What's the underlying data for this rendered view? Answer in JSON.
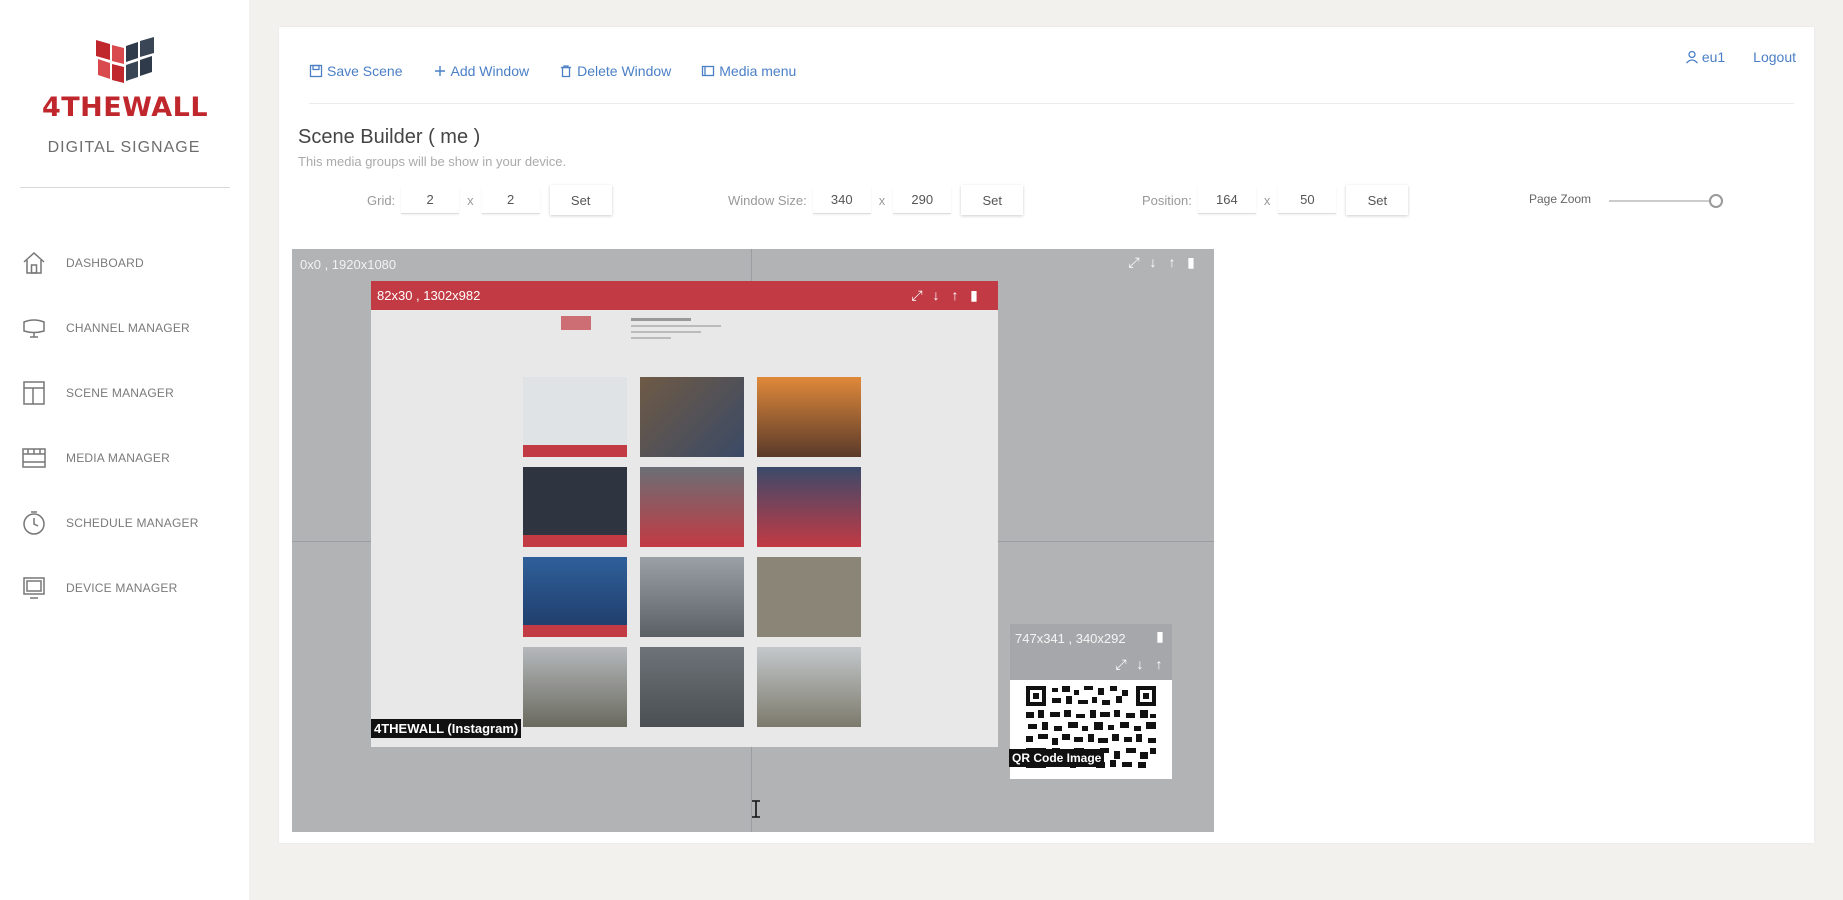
{
  "brand": {
    "name": "4THEWALL",
    "subtitle": "DIGITAL SIGNAGE",
    "accent": "#c0272d"
  },
  "sidebar": {
    "items": [
      {
        "label": "DASHBOARD",
        "icon": "home-icon"
      },
      {
        "label": "CHANNEL MANAGER",
        "icon": "monitor-icon"
      },
      {
        "label": "SCENE MANAGER",
        "icon": "layout-icon"
      },
      {
        "label": "MEDIA MANAGER",
        "icon": "film-icon"
      },
      {
        "label": "SCHEDULE MANAGER",
        "icon": "clock-icon"
      },
      {
        "label": "DEVICE MANAGER",
        "icon": "device-icon"
      }
    ]
  },
  "toolbar": {
    "save": "Save Scene",
    "add": "Add Window",
    "delete": "Delete Window",
    "media": "Media menu"
  },
  "user": {
    "name": "eu1",
    "logout": "Logout"
  },
  "page": {
    "title": "Scene Builder ( me )",
    "subtitle": "This media groups will be show in your device."
  },
  "controls": {
    "grid_label": "Grid:",
    "grid_x": "2",
    "grid_y": "2",
    "window_size_label": "Window Size:",
    "window_w": "340",
    "window_h": "290",
    "position_label": "Position:",
    "pos_x": "164",
    "pos_y": "50",
    "set_label": "Set",
    "x_sep": "x",
    "zoom_label": "Page Zoom"
  },
  "canvas": {
    "label": "0x0 , 1920x1080",
    "window1_label": "82x30 , 1302x982",
    "window1_media": "4THEWALL (Instagram)",
    "window2_label": "747x341 , 340x292",
    "window2_media": "QR Code Image"
  }
}
